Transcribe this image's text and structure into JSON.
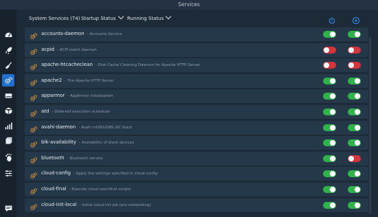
{
  "window": {
    "title": "Services"
  },
  "toolbar": {
    "count_label": "System Services (74)",
    "startup_status": "Startup Status",
    "running_status": "Running Status"
  },
  "sidebar": {
    "items": [
      {
        "icon": "dashboard-icon"
      },
      {
        "icon": "rocket-icon"
      },
      {
        "icon": "broom-icon"
      },
      {
        "icon": "gears-icon"
      },
      {
        "icon": "hdd-icon"
      },
      {
        "icon": "box-icon"
      },
      {
        "icon": "chart-icon"
      },
      {
        "icon": "cube-icon"
      },
      {
        "icon": "gnome-foot-icon"
      },
      {
        "icon": "sliders-icon"
      },
      {
        "icon": "chat-icon"
      }
    ]
  },
  "services": [
    {
      "name": "accounts-daemon",
      "desc": "- Accounts Service",
      "startup": true,
      "running": true
    },
    {
      "name": "acpid",
      "desc": "- ACPI event daemon",
      "startup": false,
      "running": false
    },
    {
      "name": "apache-htcacheclean",
      "desc": "- Disk Cache Cleaning Daemon for Apache HTTP Server",
      "startup": false,
      "running": false
    },
    {
      "name": "apache2",
      "desc": "- The Apache HTTP Server",
      "startup": true,
      "running": true
    },
    {
      "name": "apparmor",
      "desc": "- AppArmor initialization",
      "startup": true,
      "running": true
    },
    {
      "name": "atd",
      "desc": "- Deferred execution scheduler",
      "startup": true,
      "running": true
    },
    {
      "name": "avahi-daemon",
      "desc": "- Avahi mDNS/DNS-SD Stack",
      "startup": true,
      "running": true
    },
    {
      "name": "blk-availability",
      "desc": "- Availability of block devices",
      "startup": true,
      "running": true
    },
    {
      "name": "bluetooth",
      "desc": "- Bluetooth service",
      "startup": true,
      "running": false
    },
    {
      "name": "cloud-config",
      "desc": "- Apply the settings specified in cloud-config",
      "startup": true,
      "running": true
    },
    {
      "name": "cloud-final",
      "desc": "- Execute cloud user/final scripts",
      "startup": true,
      "running": true
    },
    {
      "name": "cloud-init-local",
      "desc": "- Initial cloud-init job (pre-networking)",
      "startup": true,
      "running": true
    }
  ],
  "colors": {
    "accent": "#1e6fd0",
    "on": "#2fb34a",
    "off": "#d6333a"
  }
}
